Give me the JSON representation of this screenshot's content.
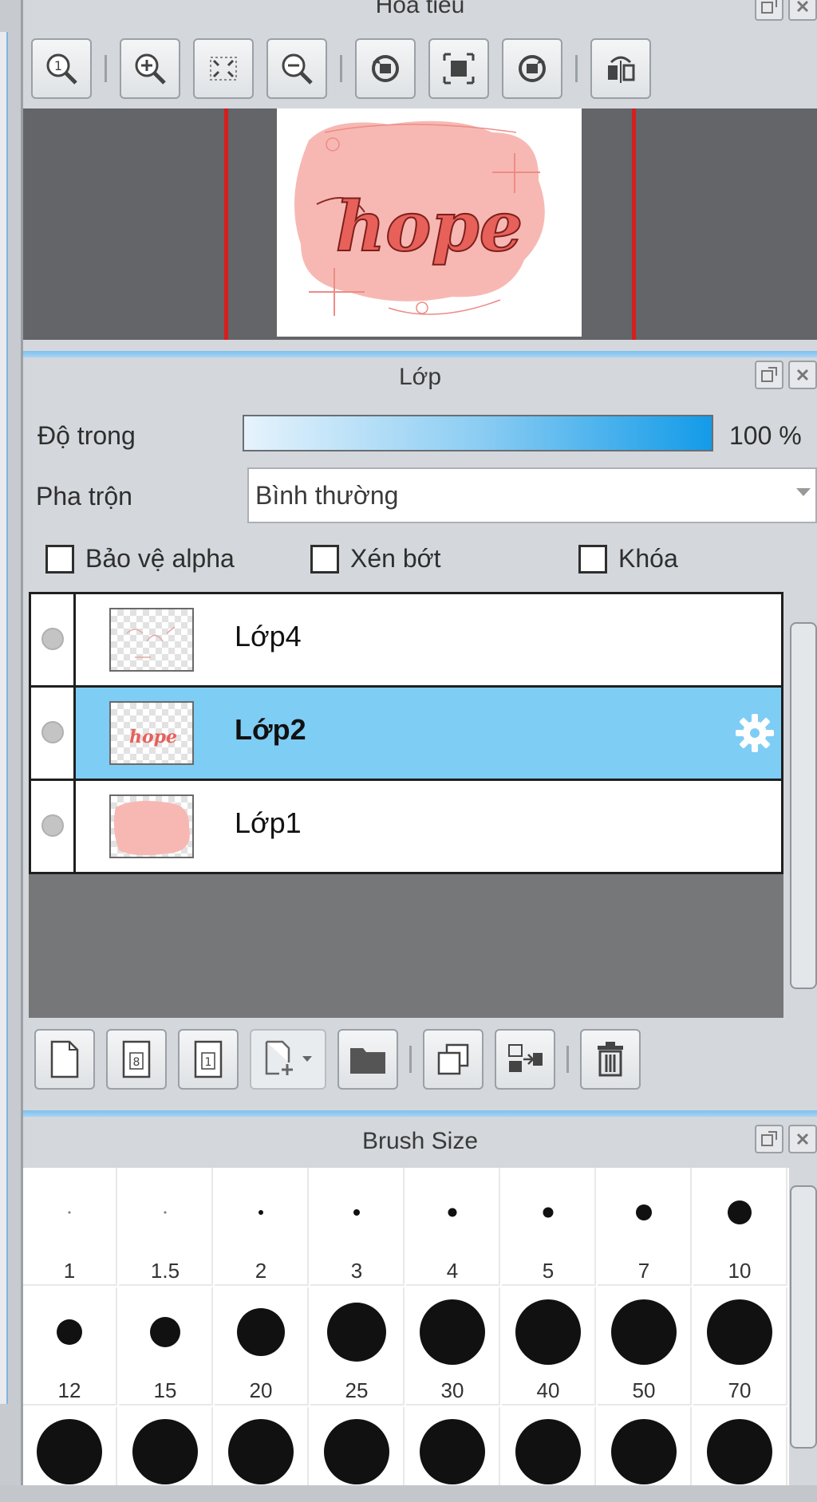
{
  "navigator": {
    "title": "Hoa tiêu",
    "thumbnail_text": "hope",
    "tools": [
      {
        "icon": "zoom-reset-icon"
      },
      {
        "icon": "zoom-in-icon"
      },
      {
        "icon": "fit-screen-icon"
      },
      {
        "icon": "zoom-out-icon"
      },
      {
        "icon": "rotate-left-icon"
      },
      {
        "icon": "reset-rotation-icon"
      },
      {
        "icon": "rotate-right-icon"
      },
      {
        "icon": "flip-horizontal-icon"
      }
    ]
  },
  "layer_panel": {
    "title": "Lớp",
    "opacity_label": "Độ trong",
    "opacity_value": "100 %",
    "opacity_fraction": 1.0,
    "blend_label": "Pha trộn",
    "blend_value": "Bình thường",
    "checkboxes": {
      "alpha_protect": "Bảo vệ alpha",
      "clipping": "Xén bớt",
      "lock": "Khóa"
    },
    "layers": [
      {
        "name": "Lớp4",
        "selected": false
      },
      {
        "name": "Lớp2",
        "selected": true
      },
      {
        "name": "Lớp1",
        "selected": false
      }
    ],
    "toolbar": [
      {
        "icon": "new-layer-icon"
      },
      {
        "icon": "new-8bit-layer-icon",
        "glyph": "8"
      },
      {
        "icon": "new-1bit-layer-icon",
        "glyph": "1"
      },
      {
        "icon": "add-layer-dropdown-icon"
      },
      {
        "icon": "new-folder-icon"
      },
      {
        "icon": "duplicate-layer-icon"
      },
      {
        "icon": "merge-down-icon"
      },
      {
        "icon": "delete-layer-icon"
      }
    ]
  },
  "brush_panel": {
    "title": "Brush Size",
    "sizes": [
      "1",
      "1.5",
      "2",
      "3",
      "4",
      "5",
      "7",
      "10",
      "12",
      "15",
      "20",
      "25",
      "30",
      "40",
      "50",
      "70",
      "",
      "",
      "",
      "",
      "",
      "",
      "",
      ""
    ]
  },
  "colors": {
    "accent": "#139be8",
    "selected_row": "#7ecdf5",
    "red_guide": "#d61e1e",
    "sketch_pink": "#f7b8b3",
    "lettering": "#e8605a"
  }
}
